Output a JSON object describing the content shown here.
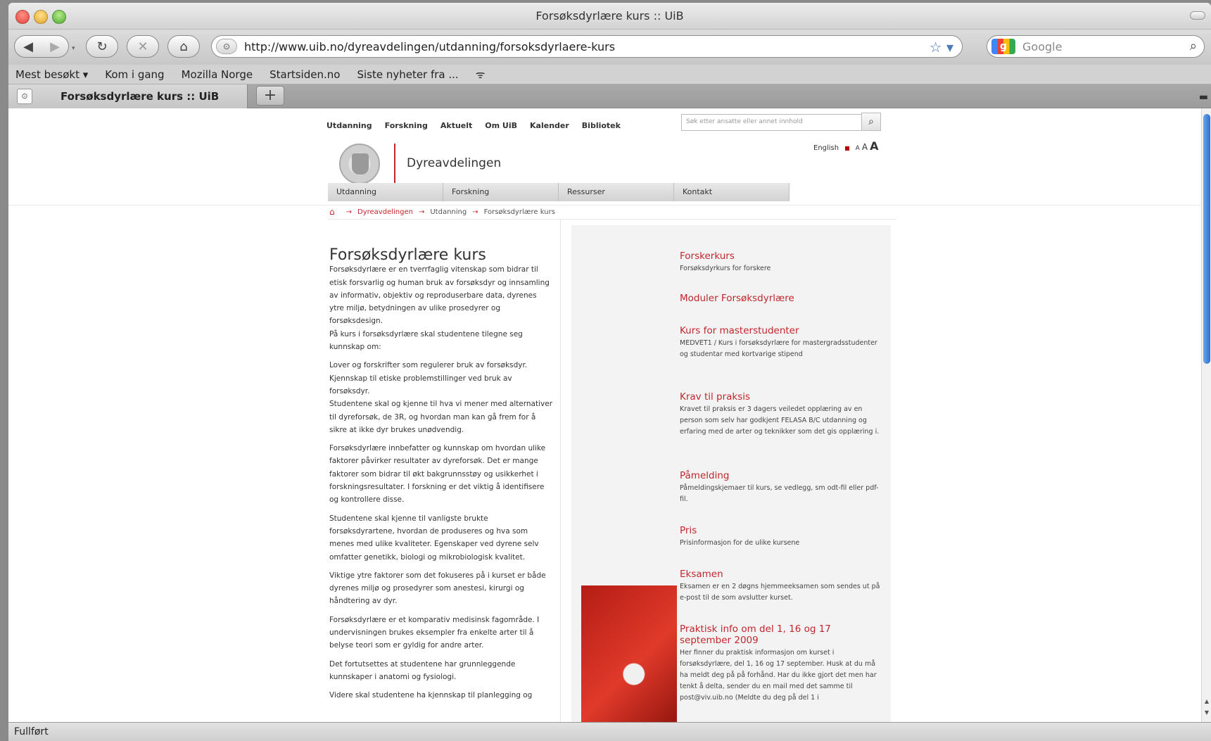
{
  "window": {
    "title": "Forsøksdyrlære kurs :: UiB"
  },
  "nav": {
    "url": "http://www.uib.no/dyreavdelingen/utdanning/forsoksdyrlaere-kurs",
    "search_placeholder": "Google"
  },
  "bookmarks": [
    "Mest besøkt ▾",
    "Kom i gang",
    "Mozilla Norge",
    "Startsiden.no",
    "Siste nyheter fra ..."
  ],
  "tab": {
    "label": "Forsøksdyrlære kurs :: UiB",
    "new_tab": "+"
  },
  "status": "Fullført",
  "page": {
    "topnav": [
      "Utdanning",
      "Forskning",
      "Aktuelt",
      "Om UiB",
      "Kalender",
      "Bibliotek"
    ],
    "search_placeholder": "Søk etter ansatte eller annet innhold",
    "lang": {
      "english": "English",
      "sep": "■",
      "a_small": "A",
      "a_medium": "A",
      "a_large": "A"
    },
    "dept_name": "Dyreavdelingen",
    "mainnav": [
      "Utdanning",
      "Forskning",
      "Ressurser",
      "Kontakt"
    ],
    "breadcrumb": [
      "Dyreavdelingen",
      "Utdanning",
      "Forsøksdyrlære kurs"
    ],
    "heading": "Forsøksdyrlære kurs",
    "paragraphs": [
      "Forsøksdyrlære er en tverrfaglig vitenskap som bidrar til etisk forsvarlig og human bruk av forsøksdyr og innsamling av informativ, objektiv og reproduserbare data, dyrenes ytre miljø, betydningen av ulike prosedyrer og forsøksdesign.\nPå kurs i forsøksdyrlære skal studentene tilegne seg kunnskap om:",
      "Lover og forskrifter som regulerer bruk av forsøksdyr.\nKjennskap til etiske problemstillinger ved bruk av forsøksdyr.\nStudentene skal og kjenne til hva vi mener med alternativer til dyreforsøk, de 3R, og hvordan man kan gå frem for å sikre at ikke dyr brukes unødvendig.",
      "Forsøksdyrlære innbefatter og kunnskap om hvordan ulike faktorer påvirker resultater av dyreforsøk. Det er mange faktorer som bidrar til økt bakgrunnsstøy og usikkerhet i forskningsresultater. I forskning er det viktig å identifisere og kontrollere disse.",
      "Studentene skal kjenne til vanligste brukte forsøksdyrartene, hvordan de produseres og hva som menes med ulike kvaliteter. Egenskaper ved dyrene selv omfatter genetikk, biologi og mikrobiologisk kvalitet.",
      "Viktige ytre faktorer som det fokuseres på i kurset er både dyrenes miljø og prosedyrer som anestesi, kirurgi og håndtering av dyr.",
      "Forsøksdyrlære er et komparativ medisinsk fagområde. I undervisningen brukes eksempler fra enkelte arter til å belyse teori som er gyldig for andre arter.",
      "Det fortutsettes at studentene har grunnleggende kunnskaper i anatomi og fysiologi.",
      "Videre skal studentene ha kjennskap til planlegging og"
    ],
    "right_items": [
      {
        "title": "Forskerkurs",
        "desc": "Forsøksdyrkurs for forskere"
      },
      {
        "title": "Moduler Forsøksdyrlære",
        "desc": ""
      },
      {
        "title": "Kurs for masterstudenter",
        "desc": "MEDVET1 / Kurs i forsøksdyrlære for mastergradsstudenter og studentar med kortvarige stipend"
      },
      {
        "title": "Krav til praksis",
        "desc": "Kravet til praksis er 3 dagers veiledet opplæring av en person som selv har godkjent FELASA B/C utdanning og erfaring med de arter og teknikker som det gis opplæring i."
      },
      {
        "title": "Påmelding",
        "desc": "Påmeldingskjemaer til kurs, se vedlegg, sm odt-fil eller pdf-fil."
      },
      {
        "title": "Pris",
        "desc": "Prisinformasjon for de ulike kursene"
      },
      {
        "title": "Eksamen",
        "desc": "Eksamen er en 2 døgns hjemmeeksamen som sendes ut på e-post til de som avslutter kurset."
      },
      {
        "title": "Praktisk info om del 1, 16 og 17 september 2009",
        "desc": "Her finner du praktisk informasjon om kurset i forsøksdyrlære, del 1, 16 og 17 september. Husk at du må ha meldt deg på på forhånd. Har du ikke gjort det men har tenkt å delta, sender du en mail med det samme til post@viv.uib.no (Meldte du deg på del 1 i"
      }
    ]
  },
  "colors": {
    "uib_red": "#c0262d",
    "panel_gray": "#f3f3f3"
  },
  "icons": [
    "back-icon",
    "forward-icon",
    "reload-icon",
    "stop-icon",
    "home-icon",
    "bookmark-star-icon",
    "search-icon",
    "rss-icon",
    "seal-logo"
  ]
}
